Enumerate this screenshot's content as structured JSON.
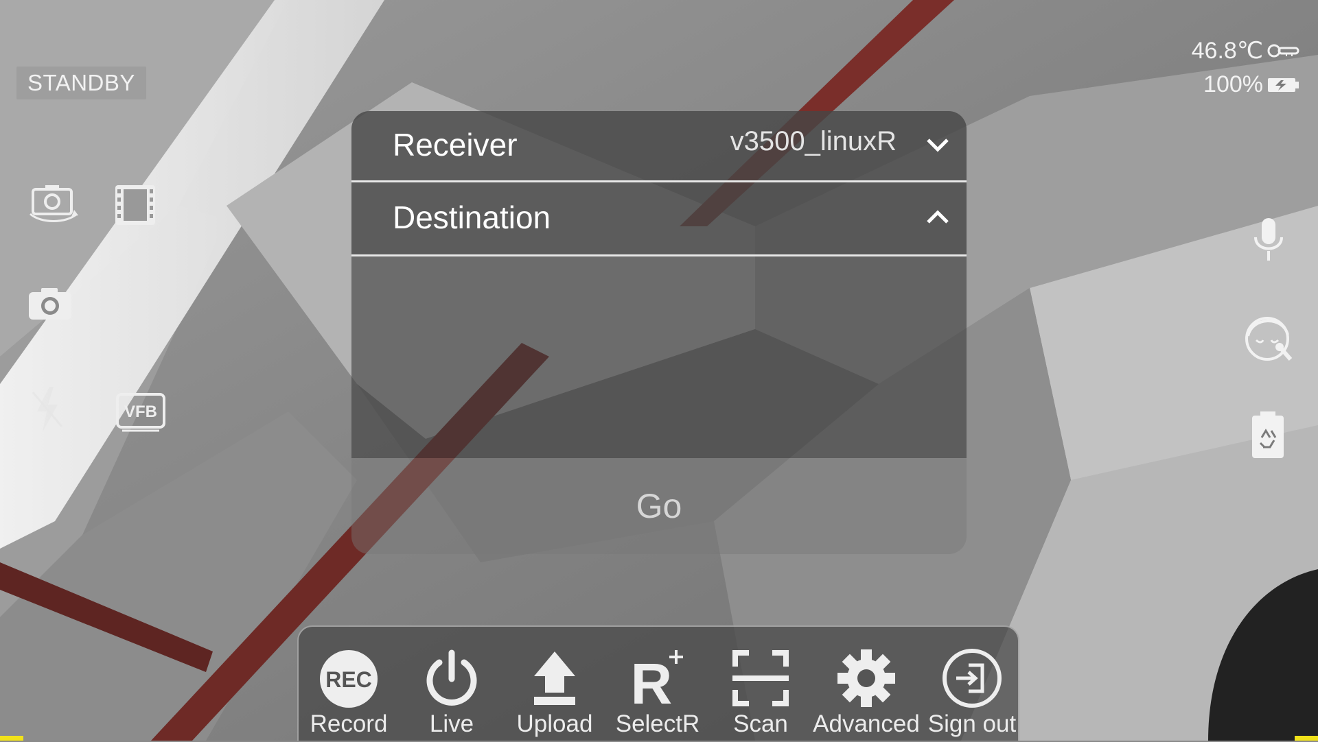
{
  "status": {
    "mode": "STANDBY",
    "temperature": "46.8℃",
    "battery": "100%"
  },
  "left_icons": [
    {
      "name": "switch-camera-icon"
    },
    {
      "name": "film-icon"
    },
    {
      "name": "snapshot-camera-icon"
    },
    {
      "name": "flash-off-icon"
    },
    {
      "name": "vfb-icon",
      "text": "VFB"
    }
  ],
  "right_icons": [
    {
      "name": "microphone-icon"
    },
    {
      "name": "beauty-face-icon"
    },
    {
      "name": "clear-cache-icon"
    }
  ],
  "panel": {
    "receiver_label": "Receiver",
    "receiver_value": "v3500_linuxR",
    "destination_label": "Destination",
    "go_label": "Go"
  },
  "toolbar": {
    "items": [
      {
        "label": "Record",
        "icon": "rec-icon",
        "icon_text": "REC"
      },
      {
        "label": "Live",
        "icon": "power-icon"
      },
      {
        "label": "Upload",
        "icon": "upload-icon"
      },
      {
        "label": "SelectR",
        "icon": "select-receiver-icon",
        "icon_text": "R"
      },
      {
        "label": "Scan",
        "icon": "scan-icon"
      },
      {
        "label": "Advanced",
        "icon": "gear-icon"
      },
      {
        "label": "Sign out",
        "icon": "sign-out-icon"
      }
    ]
  },
  "colors": {
    "panel_bg": "#464646",
    "divider": "#e8e8e8",
    "accent_yellow": "#f1e21a"
  }
}
